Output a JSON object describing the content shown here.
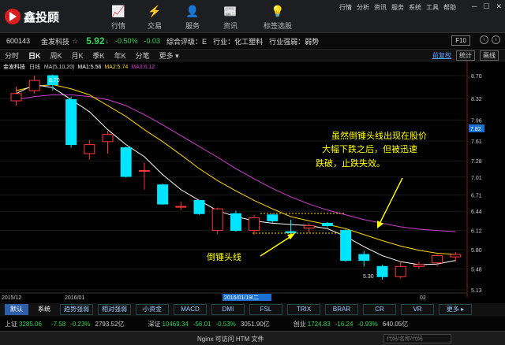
{
  "brand": {
    "name": "鑫投顾"
  },
  "nav": [
    {
      "label": "行情",
      "icon": "chart-line-icon",
      "glyph": "📈"
    },
    {
      "label": "交易",
      "icon": "trade-icon",
      "glyph": "⚡"
    },
    {
      "label": "服务",
      "icon": "person-icon",
      "glyph": "👤"
    },
    {
      "label": "资讯",
      "icon": "news-icon",
      "glyph": "📰"
    },
    {
      "label": "标签选股",
      "icon": "bulb-icon",
      "glyph": "💡"
    }
  ],
  "top_links": [
    "行情",
    "分析",
    "资讯",
    "服务",
    "系统",
    "工具",
    "帮助"
  ],
  "quote": {
    "code": "600143",
    "name": "金发科技",
    "price": "5.92",
    "arrow": "↓",
    "change_pct": "-0.50%",
    "change": "-0.03",
    "rating": "综合评级：E",
    "industry": "行业：化工塑料",
    "industry_strength": "行业强弱：弱势",
    "f10": "F10"
  },
  "periods": [
    "分时",
    "日K",
    "周K",
    "月K",
    "季K",
    "年K",
    "分笔",
    "更多 ▾"
  ],
  "period_active": "日K",
  "adjust": {
    "label": "前复权",
    "btn1": "统计",
    "btn2": "画线"
  },
  "legend": {
    "name": "金发科技",
    "period": "日线",
    "ma_label": "MA(5,10,20)",
    "ma1": "MA1:5.56",
    "ma2": "MA2:5.74",
    "ma3": "MA3:6.12"
  },
  "annotations": {
    "top_price": "8.70",
    "low_price": "5.30",
    "note1": "虽然倒锤头线出现在股价",
    "note2": "大幅下跌之后，但被迅速",
    "note3": "跌破，止跌失效。",
    "hammer": "倒锤头线"
  },
  "time_axis": {
    "t1": "2015/12",
    "t2": "2016/01",
    "cursor": "2016/01/19/二",
    "t3": "02"
  },
  "last_price_tag": "7.82",
  "indicators": {
    "default": "默认",
    "system": "系统",
    "items": [
      "趋势强弱",
      "相对强弱",
      "小资金",
      "MACD",
      "DMI",
      "FSL",
      "TRIX",
      "BRAR",
      "CR",
      "VR",
      "更多 ▸"
    ]
  },
  "ticker": {
    "sh_label": "上证",
    "sh_val": "3285.06",
    "sh_chg": "-7.58",
    "sh_pct": "-0.23%",
    "sh_amt": "2793.52亿",
    "sz_label": "深证",
    "sz_val": "10469.34",
    "sz_chg": "-56.01",
    "sz_pct": "-0.53%",
    "sz_amt": "3051.90亿",
    "cy_label": "创业",
    "cy_val": "1724.83",
    "cy_chg": "-16.24",
    "cy_pct": "-0.93%",
    "cy_amt": "640.05亿"
  },
  "status": {
    "text": "Nginx 可访问 HTM 文件",
    "search_placeholder": "代码/名称/代码"
  },
  "colors": {
    "up": "#ff3b3b",
    "down": "#00e5ff",
    "ma1": "#ffffff",
    "ma2": "#ffd700",
    "ma3": "#d23fd2",
    "note": "#ffff00"
  },
  "chart_data": {
    "type": "candlestick",
    "y_ticks": [
      8.7,
      8.32,
      7.96,
      7.61,
      7.28,
      7.01,
      6.71,
      6.44,
      6.12,
      5.8,
      5.48,
      5.13
    ],
    "ylim": [
      5.13,
      8.7
    ],
    "candles": [
      {
        "o": 8.28,
        "c": 8.4,
        "h": 8.52,
        "l": 8.2
      },
      {
        "o": 8.45,
        "c": 8.62,
        "h": 8.7,
        "l": 8.4
      },
      {
        "o": 8.7,
        "c": 8.55,
        "h": 8.72,
        "l": 8.45
      },
      {
        "o": 8.3,
        "c": 7.55,
        "h": 8.35,
        "l": 7.5
      },
      {
        "o": 7.4,
        "c": 7.55,
        "h": 7.62,
        "l": 7.3
      },
      {
        "o": 7.6,
        "c": 7.72,
        "h": 7.78,
        "l": 7.4
      },
      {
        "o": 7.5,
        "c": 7.02,
        "h": 7.52,
        "l": 7.0
      },
      {
        "o": 7.12,
        "c": 7.12,
        "h": 7.25,
        "l": 6.8
      },
      {
        "o": 6.88,
        "c": 6.56,
        "h": 6.9,
        "l": 6.55
      },
      {
        "o": 6.52,
        "c": 6.52,
        "h": 6.6,
        "l": 6.46
      },
      {
        "o": 6.62,
        "c": 6.4,
        "h": 6.62,
        "l": 6.38
      },
      {
        "o": 6.12,
        "c": 6.48,
        "h": 6.5,
        "l": 6.06
      },
      {
        "o": 6.4,
        "c": 6.12,
        "h": 6.45,
        "l": 6.1
      },
      {
        "o": 6.12,
        "c": 6.33,
        "h": 6.38,
        "l": 6.05
      },
      {
        "o": 6.38,
        "c": 6.28,
        "h": 6.4,
        "l": 6.25
      },
      {
        "o": 6.1,
        "c": 6.08,
        "h": 6.3,
        "l": 6.05
      },
      {
        "o": 6.16,
        "c": 6.2,
        "h": 6.24,
        "l": 6.08
      },
      {
        "o": 6.24,
        "c": 6.2,
        "h": 6.26,
        "l": 6.17
      },
      {
        "o": 6.12,
        "c": 5.62,
        "h": 6.15,
        "l": 5.6
      },
      {
        "o": 5.72,
        "c": 5.62,
        "h": 5.78,
        "l": 5.52
      },
      {
        "o": 5.52,
        "c": 5.35,
        "h": 5.55,
        "l": 5.3
      },
      {
        "o": 5.35,
        "c": 5.52,
        "h": 5.6,
        "l": 5.32
      },
      {
        "o": 5.52,
        "c": 5.55,
        "h": 5.6,
        "l": 5.48
      },
      {
        "o": 5.58,
        "c": 5.7,
        "h": 5.72,
        "l": 5.52
      },
      {
        "o": 5.68,
        "c": 5.72,
        "h": 5.76,
        "l": 5.6
      }
    ],
    "ma1": [
      8.4,
      8.55,
      8.5,
      8.3,
      8.1,
      7.8,
      7.55,
      7.35,
      7.05,
      6.8,
      6.62,
      6.45,
      6.35,
      6.28,
      6.24,
      6.22,
      6.2,
      6.15,
      6.02,
      5.85,
      5.7,
      5.6,
      5.55,
      5.56,
      5.62
    ],
    "ma2": [
      8.45,
      8.52,
      8.55,
      8.48,
      8.38,
      8.2,
      8.02,
      7.8,
      7.6,
      7.38,
      7.15,
      6.95,
      6.78,
      6.62,
      6.48,
      6.35,
      6.28,
      6.22,
      6.15,
      6.05,
      5.95,
      5.86,
      5.79,
      5.74,
      5.72
    ],
    "ma3": [
      8.3,
      8.35,
      8.38,
      8.38,
      8.35,
      8.3,
      8.2,
      8.05,
      7.88,
      7.7,
      7.52,
      7.34,
      7.15,
      6.98,
      6.82,
      6.68,
      6.56,
      6.46,
      6.38,
      6.3,
      6.24,
      6.18,
      6.14,
      6.12,
      6.1
    ]
  }
}
